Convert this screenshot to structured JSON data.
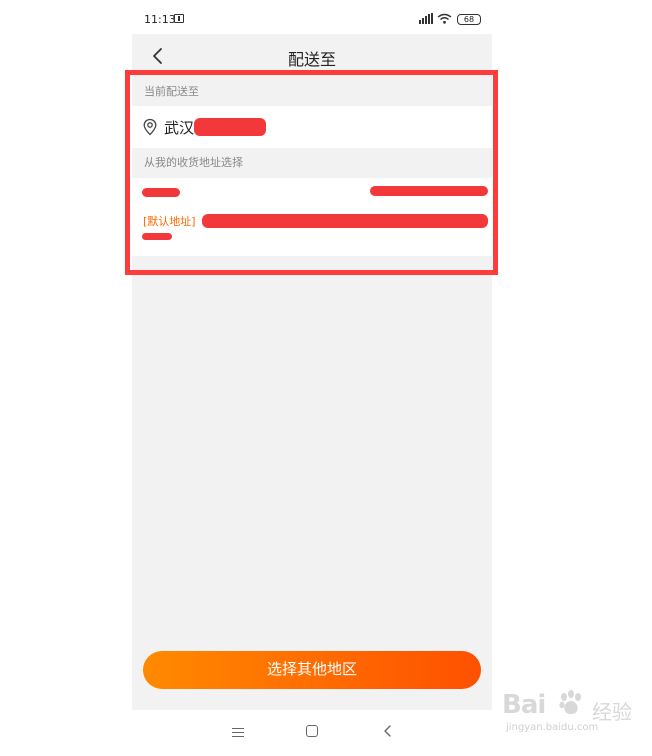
{
  "status_bar": {
    "time": "11:13",
    "battery": "68"
  },
  "nav": {
    "title": "配送至"
  },
  "current": {
    "section_label": "当前配送至",
    "city": "武汉"
  },
  "saved": {
    "section_label": "从我的收货地址选择",
    "default_tag": "[默认地址]"
  },
  "action": {
    "select_other_label": "选择其他地区"
  },
  "watermark": {
    "brand": "Bai",
    "sub": "经验",
    "url": "jingyan.baidu.com"
  },
  "colors": {
    "accent": "#ff6a00",
    "button_start": "#ff8a00",
    "button_end": "#ff5000",
    "highlight": "#ff3b3b",
    "redaction": "#f2383a"
  }
}
